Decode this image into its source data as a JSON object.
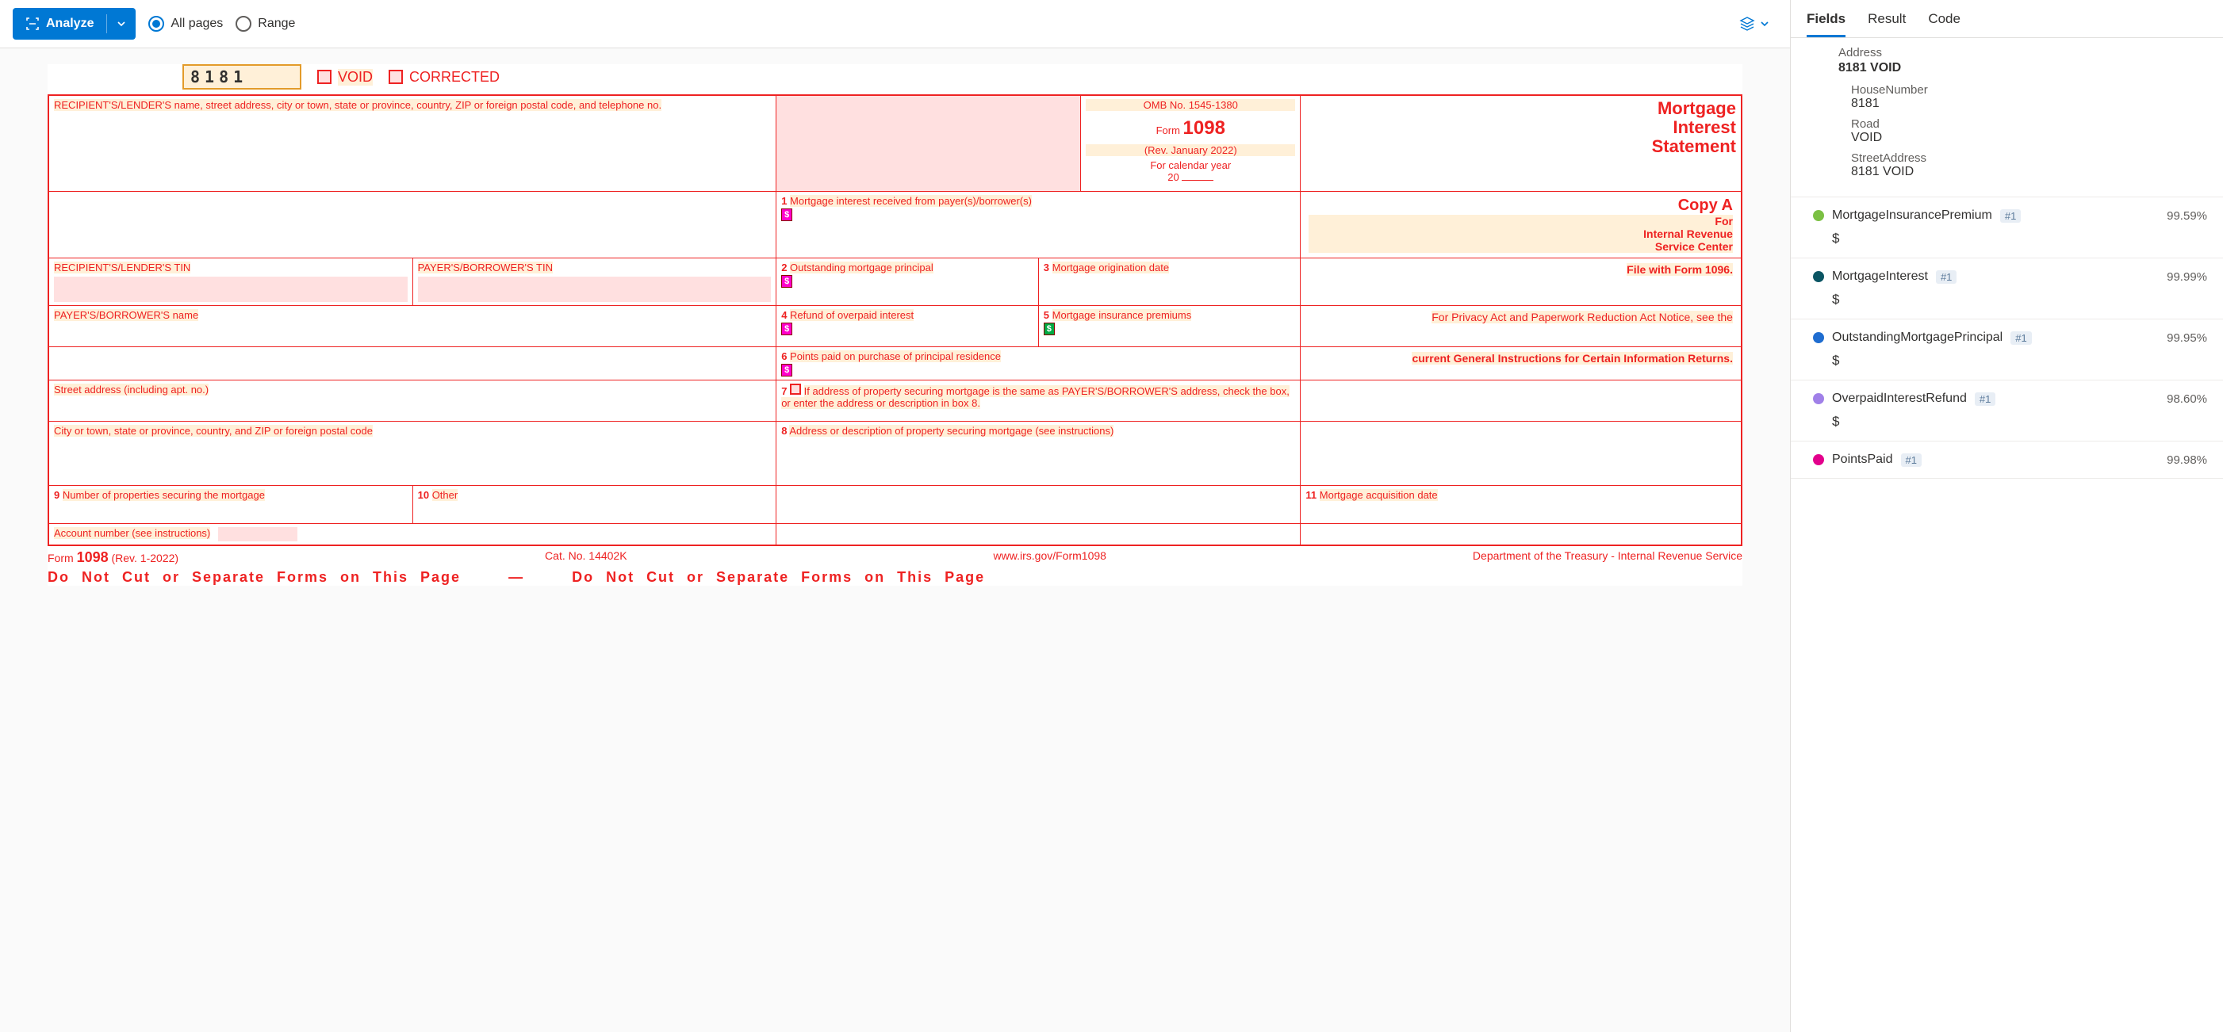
{
  "toolbar": {
    "analyze_label": "Analyze",
    "all_pages_label": "All pages",
    "range_label": "Range"
  },
  "form": {
    "ocr_code": "8181",
    "void_label": "VOID",
    "corrected_label": "CORRECTED",
    "recipient_block": "RECIPIENT'S/LENDER'S name, street address, city or town, state or province, country, ZIP or foreign postal code, and telephone no.",
    "omb": "OMB No. 1545-1380",
    "form_label": "Form",
    "form_number": "1098",
    "rev": "(Rev. January 2022)",
    "cal_year": "For calendar year",
    "year_prefix": "20",
    "title_l1": "Mortgage",
    "title_l2": "Interest",
    "title_l3": "Statement",
    "box1": "Mortgage interest received from payer(s)/borrower(s)",
    "box2": "Outstanding mortgage principal",
    "box3": "Mortgage origination date",
    "box4": "Refund of overpaid interest",
    "box5": "Mortgage insurance premiums",
    "box6": "Points paid on purchase of principal residence",
    "box7": "If address of property securing mortgage is the same as PAYER'S/BORROWER'S address, check the box, or enter the address or description in box 8.",
    "box8": "Address or description of property securing mortgage (see instructions)",
    "box9": "Number of properties securing the mortgage",
    "box10": "Other",
    "box11": "Mortgage acquisition date",
    "recip_tin": "RECIPIENT'S/LENDER'S TIN",
    "payer_tin": "PAYER'S/BORROWER'S TIN",
    "payer_name": "PAYER'S/BORROWER'S name",
    "street": "Street address (including apt. no.)",
    "city": "City or town, state or province, country, and ZIP or foreign postal code",
    "acct": "Account number (see instructions)",
    "copy_a": "Copy A",
    "for": "For",
    "irs1": "Internal Revenue",
    "irs2": "Service Center",
    "file_1096": "File with Form 1096.",
    "privacy": "For Privacy Act and Paperwork Reduction Act Notice, see the",
    "current_gen": "current General Instructions for Certain Information Returns.",
    "foot_form": "Form",
    "foot_num": "1098",
    "foot_rev": "(Rev. 1-2022)",
    "foot_cat": "Cat. No. 14402K",
    "foot_url": "www.irs.gov/Form1098",
    "foot_dept": "Department of the Treasury - Internal Revenue Service",
    "dont_cut": "Do  Not  Cut  or  Separate  Forms  on  This  Page",
    "dash": "—"
  },
  "panel": {
    "tabs": {
      "fields": "Fields",
      "result": "Result",
      "code": "Code"
    },
    "address": {
      "label": "Address",
      "value": "8181 VOID",
      "house_label": "HouseNumber",
      "house_val": "8181",
      "road_label": "Road",
      "road_val": "VOID",
      "street_label": "StreetAddress",
      "street_val": "8181 VOID"
    },
    "fields": [
      {
        "name": "MortgageInsurancePremium",
        "badge": "#1",
        "conf": "99.59%",
        "value": "$",
        "color": "#7bc043"
      },
      {
        "name": "MortgageInterest",
        "badge": "#1",
        "conf": "99.99%",
        "value": "$",
        "color": "#0b5563"
      },
      {
        "name": "OutstandingMortgagePrincipal",
        "badge": "#1",
        "conf": "99.95%",
        "value": "$",
        "color": "#1f6dd0"
      },
      {
        "name": "OverpaidInterestRefund",
        "badge": "#1",
        "conf": "98.60%",
        "value": "$",
        "color": "#a080e8"
      },
      {
        "name": "PointsPaid",
        "badge": "#1",
        "conf": "99.98%",
        "value": "",
        "color": "#e3008c"
      }
    ]
  }
}
